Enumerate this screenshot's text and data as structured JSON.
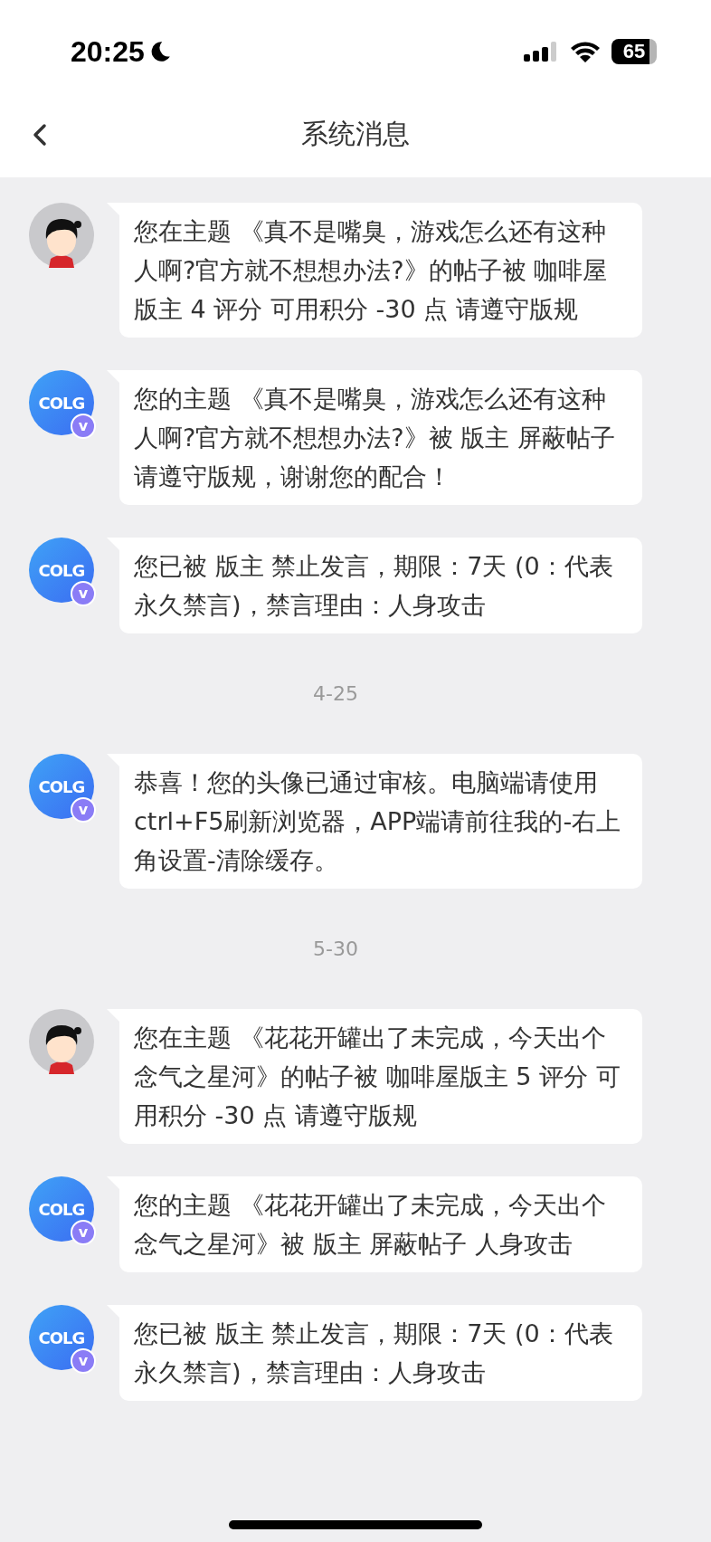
{
  "status_bar": {
    "time": "20:25",
    "battery": "65"
  },
  "nav": {
    "title": "系统消息"
  },
  "messages": [
    {
      "kind": "message",
      "avatar": {
        "kind": "user"
      },
      "text": "您在主题 《真不是嘴臭，游戏怎么还有这种人啊?官方就不想想办法?》的帖子被 咖啡屋版主 4 评分 可用积分 -30 点 请遵守版规"
    },
    {
      "kind": "message",
      "avatar": {
        "kind": "logo",
        "logo_text": "COLG",
        "badge_text": "v"
      },
      "text": "您的主题 《真不是嘴臭，游戏怎么还有这种人啊?官方就不想想办法?》被 版主 屏蔽帖子请遵守版规，谢谢您的配合！"
    },
    {
      "kind": "message",
      "avatar": {
        "kind": "logo",
        "logo_text": "COLG",
        "badge_text": "v"
      },
      "text": "您已被 版主 禁止发言，期限：7天 (0：代表永久禁言)，禁言理由：人身攻击"
    },
    {
      "kind": "date",
      "text": "4-25"
    },
    {
      "kind": "message",
      "avatar": {
        "kind": "logo",
        "logo_text": "COLG",
        "badge_text": "v"
      },
      "text": "恭喜！您的头像已通过审核。电脑端请使用ctrl+F5刷新浏览器，APP端请前往我的-右上角设置-清除缓存。"
    },
    {
      "kind": "date",
      "text": "5-30"
    },
    {
      "kind": "message",
      "avatar": {
        "kind": "user"
      },
      "text": "您在主题 《花花开罐出了未完成，今天出个念气之星河》的帖子被 咖啡屋版主 5 评分 可用积分 -30 点 请遵守版规"
    },
    {
      "kind": "message",
      "avatar": {
        "kind": "logo",
        "logo_text": "COLG",
        "badge_text": "v"
      },
      "text": "您的主题 《花花开罐出了未完成，今天出个念气之星河》被 版主 屏蔽帖子 人身攻击"
    },
    {
      "kind": "message",
      "avatar": {
        "kind": "logo",
        "logo_text": "COLG",
        "badge_text": "v"
      },
      "text": "您已被 版主 禁止发言，期限：7天 (0：代表永久禁言)，禁言理由：人身攻击"
    }
  ]
}
